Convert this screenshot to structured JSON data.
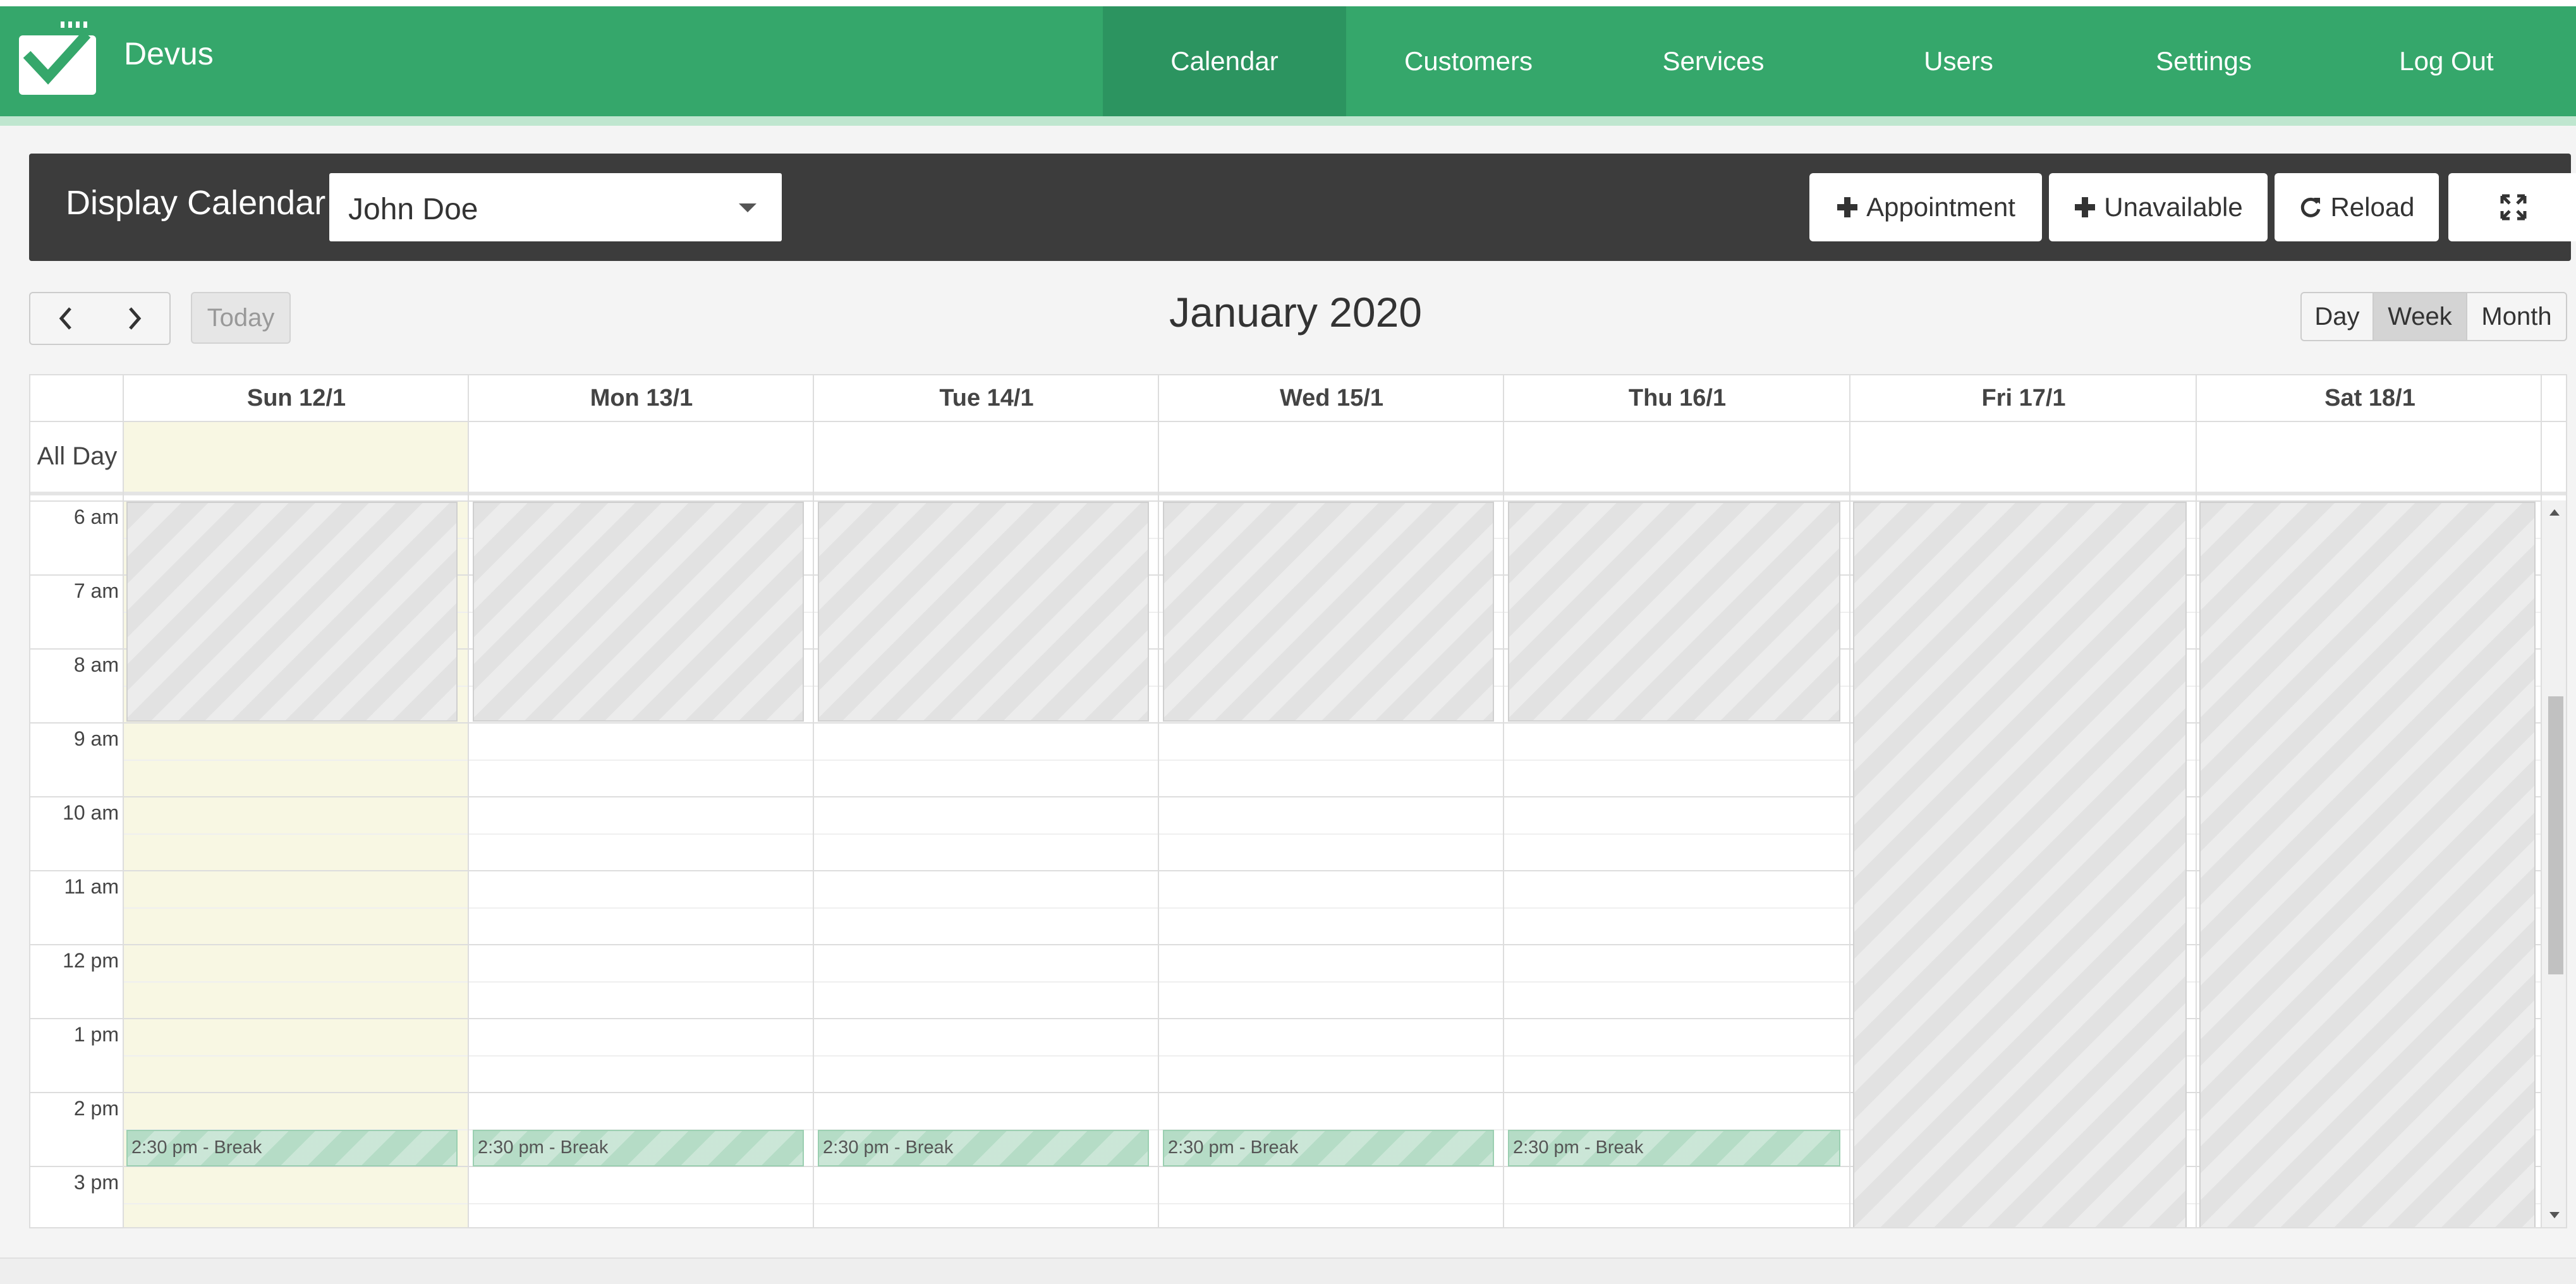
{
  "header": {
    "brand": "Devus",
    "nav": [
      "Calendar",
      "Customers",
      "Services",
      "Users",
      "Settings",
      "Log Out"
    ],
    "active_nav": "Calendar"
  },
  "toolbar": {
    "label": "Display Calendar",
    "provider_value": "John Doe",
    "buttons": {
      "appointment": "Appointment",
      "unavailable": "Unavailable",
      "reload": "Reload"
    }
  },
  "calendar": {
    "today_label": "Today",
    "title": "January 2020",
    "views": [
      "Day",
      "Week",
      "Month"
    ],
    "active_view": "Week",
    "days": [
      "Sun 12/1",
      "Mon 13/1",
      "Tue 14/1",
      "Wed 15/1",
      "Thu 16/1",
      "Fri 17/1",
      "Sat 18/1"
    ],
    "all_day_label": "All Day",
    "hours": [
      "6 am",
      "7 am",
      "8 am",
      "9 am",
      "10 am",
      "11 am",
      "12 pm",
      "1 pm",
      "2 pm",
      "3 pm"
    ],
    "break_event_label": "2:30 pm - Break"
  },
  "colors": {
    "header_green": "#35a76b",
    "toolbar_dark": "#3c3c3c",
    "today_highlight": "#f8f7e3",
    "break_event": "#b5dcc6"
  }
}
